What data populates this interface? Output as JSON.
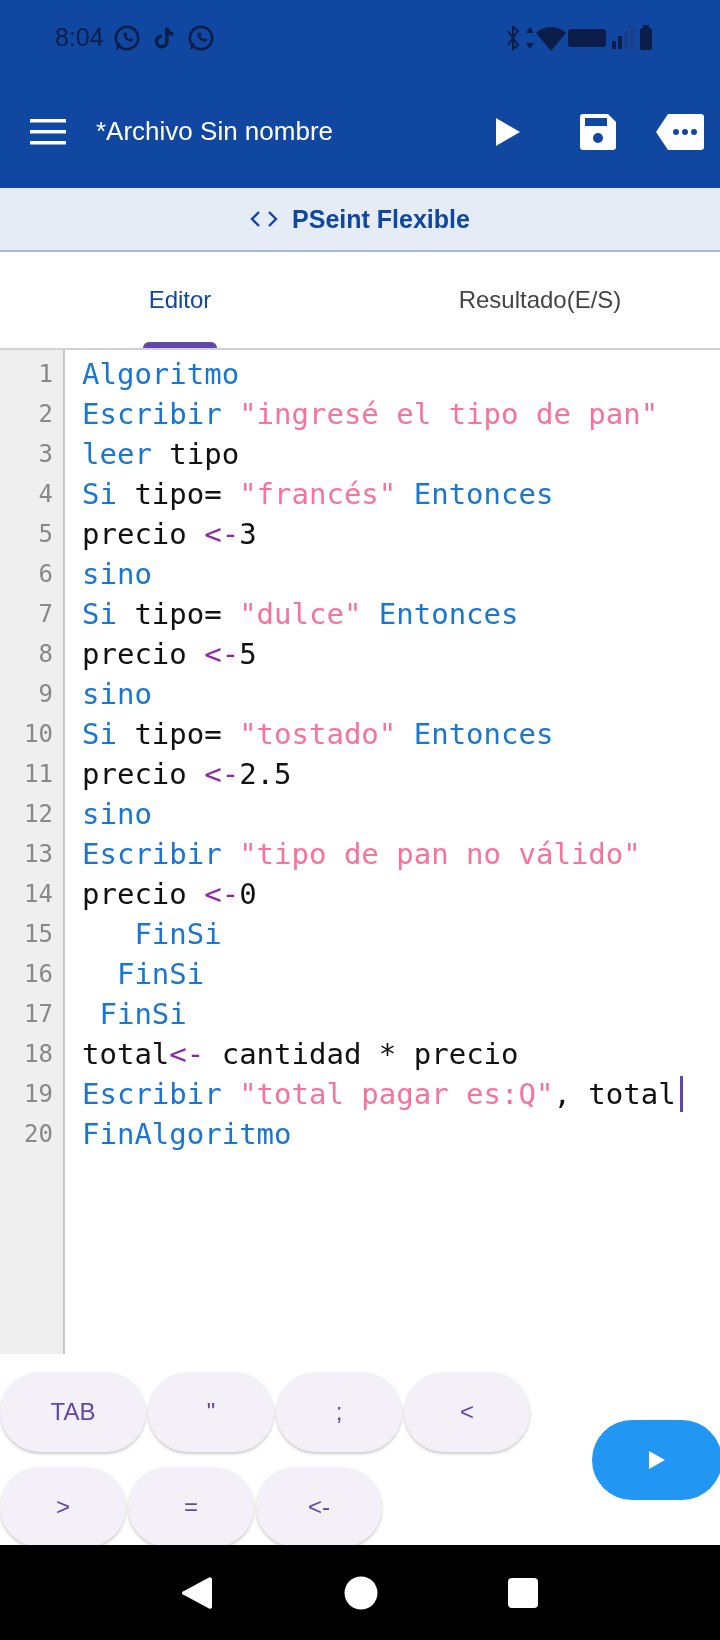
{
  "status_bar": {
    "time": "8:04"
  },
  "app_bar": {
    "title": "*Archivo Sin nombre"
  },
  "mode_bar": {
    "title": "PSeint Flexible"
  },
  "tabs": [
    {
      "label": "Editor",
      "selected": true
    },
    {
      "label": "Resultado(E/S)",
      "selected": false
    }
  ],
  "editor": {
    "lines": [
      {
        "number": "1",
        "tokens": [
          {
            "kind": "keyword",
            "text": "Algoritmo"
          }
        ]
      },
      {
        "number": "2",
        "tokens": [
          {
            "kind": "keyword",
            "text": "Escribir"
          },
          {
            "kind": "string",
            "text": " \"ingresé el tipo de pan\""
          }
        ]
      },
      {
        "number": "3",
        "tokens": [
          {
            "kind": "keyword",
            "text": "leer"
          },
          {
            "kind": "plain",
            "text": " tipo"
          }
        ]
      },
      {
        "number": "4",
        "tokens": [
          {
            "kind": "keyword",
            "text": "Si"
          },
          {
            "kind": "plain",
            "text": " tipo= "
          },
          {
            "kind": "string",
            "text": "\"francés\""
          },
          {
            "kind": "keyword",
            "text": " Entonces"
          }
        ]
      },
      {
        "number": "5",
        "tokens": [
          {
            "kind": "plain",
            "text": "precio "
          },
          {
            "kind": "operator",
            "text": "<-"
          },
          {
            "kind": "plain",
            "text": "3"
          }
        ]
      },
      {
        "number": "6",
        "tokens": [
          {
            "kind": "keyword",
            "text": "sino"
          }
        ]
      },
      {
        "number": "7",
        "tokens": [
          {
            "kind": "keyword",
            "text": "Si"
          },
          {
            "kind": "plain",
            "text": " tipo= "
          },
          {
            "kind": "string",
            "text": "\"dulce\""
          },
          {
            "kind": "keyword",
            "text": " Entonces"
          }
        ]
      },
      {
        "number": "8",
        "tokens": [
          {
            "kind": "plain",
            "text": "precio "
          },
          {
            "kind": "operator",
            "text": "<-"
          },
          {
            "kind": "plain",
            "text": "5"
          }
        ]
      },
      {
        "number": "9",
        "tokens": [
          {
            "kind": "keyword",
            "text": "sino"
          }
        ]
      },
      {
        "number": "10",
        "tokens": [
          {
            "kind": "keyword",
            "text": "Si"
          },
          {
            "kind": "plain",
            "text": " tipo= "
          },
          {
            "kind": "string",
            "text": "\"tostado\""
          },
          {
            "kind": "keyword",
            "text": " Entonces"
          }
        ]
      },
      {
        "number": "11",
        "tokens": [
          {
            "kind": "plain",
            "text": "precio "
          },
          {
            "kind": "operator",
            "text": "<-"
          },
          {
            "kind": "plain",
            "text": "2.5"
          }
        ]
      },
      {
        "number": "12",
        "tokens": [
          {
            "kind": "keyword",
            "text": "sino"
          }
        ]
      },
      {
        "number": "13",
        "tokens": [
          {
            "kind": "keyword",
            "text": "Escribir"
          },
          {
            "kind": "string",
            "text": " \"tipo de pan no válido\""
          }
        ]
      },
      {
        "number": "14",
        "tokens": [
          {
            "kind": "plain",
            "text": "precio "
          },
          {
            "kind": "operator",
            "text": "<-"
          },
          {
            "kind": "plain",
            "text": "0"
          }
        ]
      },
      {
        "number": "15",
        "tokens": [
          {
            "kind": "keyword",
            "text": "   FinSi"
          }
        ]
      },
      {
        "number": "16",
        "tokens": [
          {
            "kind": "keyword",
            "text": "  FinSi"
          }
        ]
      },
      {
        "number": "17",
        "tokens": [
          {
            "kind": "keyword",
            "text": " FinSi"
          }
        ]
      },
      {
        "number": "18",
        "tokens": [
          {
            "kind": "plain",
            "text": "total"
          },
          {
            "kind": "operator",
            "text": "<-"
          },
          {
            "kind": "plain",
            "text": " cantidad * precio"
          }
        ]
      },
      {
        "number": "19",
        "cursor": true,
        "tokens": [
          {
            "kind": "keyword",
            "text": "Escribir"
          },
          {
            "kind": "string",
            "text": " \"total pagar es:Q\""
          },
          {
            "kind": "plain",
            "text": ", total"
          }
        ]
      },
      {
        "number": "20",
        "tokens": [
          {
            "kind": "keyword",
            "text": "FinAlgoritmo"
          }
        ]
      }
    ]
  },
  "keys": [
    [
      "TAB",
      "\"",
      ";",
      "<"
    ],
    [
      ">",
      "=",
      "<-"
    ]
  ]
}
